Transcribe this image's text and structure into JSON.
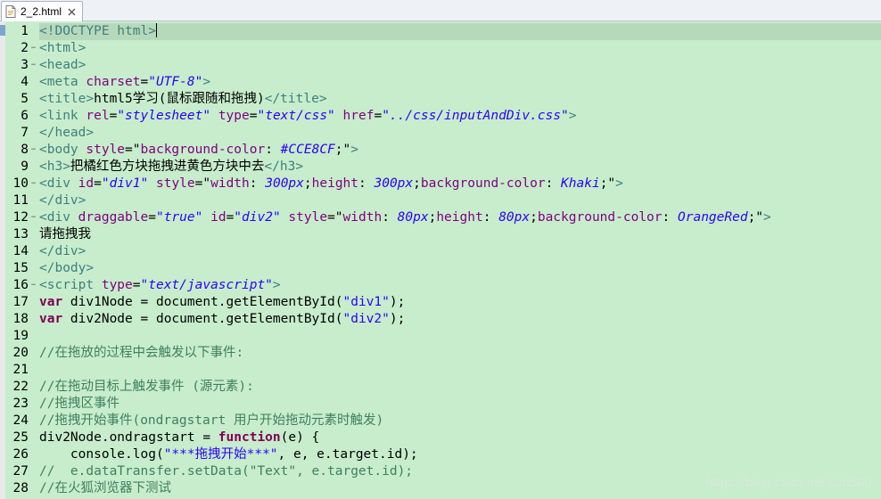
{
  "tab": {
    "title": "2_2.html"
  },
  "editor": {
    "caret_line": 1
  },
  "lines": [
    [
      {
        "c": "tag",
        "t": "<!DOCTYPE html>"
      }
    ],
    [
      {
        "c": "tag",
        "t": "<html>"
      }
    ],
    [
      {
        "c": "tag",
        "t": "<head>"
      }
    ],
    [
      {
        "c": "tag",
        "t": "<meta "
      },
      {
        "c": "attr",
        "t": "charset"
      },
      {
        "c": "plain",
        "t": "="
      },
      {
        "c": "val",
        "t": "\"UTF-8\""
      },
      {
        "c": "tag",
        "t": ">"
      }
    ],
    [
      {
        "c": "tag",
        "t": "<title>"
      },
      {
        "c": "plain",
        "t": "html5学习(鼠标跟随和拖拽)"
      },
      {
        "c": "tag",
        "t": "</title>"
      }
    ],
    [
      {
        "c": "tag",
        "t": "<link "
      },
      {
        "c": "attr",
        "t": "rel"
      },
      {
        "c": "plain",
        "t": "="
      },
      {
        "c": "val",
        "t": "\"stylesheet\""
      },
      {
        "c": "plain",
        "t": " "
      },
      {
        "c": "attr",
        "t": "type"
      },
      {
        "c": "plain",
        "t": "="
      },
      {
        "c": "val",
        "t": "\"text/css\""
      },
      {
        "c": "plain",
        "t": " "
      },
      {
        "c": "attr",
        "t": "href"
      },
      {
        "c": "plain",
        "t": "="
      },
      {
        "c": "val",
        "t": "\"../css/inputAndDiv.css\""
      },
      {
        "c": "tag",
        "t": ">"
      }
    ],
    [
      {
        "c": "tag",
        "t": "</head>"
      }
    ],
    [
      {
        "c": "tag",
        "t": "<body "
      },
      {
        "c": "attr",
        "t": "style"
      },
      {
        "c": "plain",
        "t": "=\""
      },
      {
        "c": "attr",
        "t": "background-color"
      },
      {
        "c": "plain",
        "t": ": "
      },
      {
        "c": "cval",
        "t": "#CCE8CF"
      },
      {
        "c": "plain",
        "t": ";\""
      },
      {
        "c": "tag",
        "t": ">"
      }
    ],
    [
      {
        "c": "tag",
        "t": "<h3>"
      },
      {
        "c": "plain",
        "t": "把橘红色方块拖拽进黄色方块中去"
      },
      {
        "c": "tag",
        "t": "</h3>"
      }
    ],
    [
      {
        "c": "tag",
        "t": "<div "
      },
      {
        "c": "attr",
        "t": "id"
      },
      {
        "c": "plain",
        "t": "="
      },
      {
        "c": "val",
        "t": "\"div1\""
      },
      {
        "c": "plain",
        "t": " "
      },
      {
        "c": "attr",
        "t": "style"
      },
      {
        "c": "plain",
        "t": "=\""
      },
      {
        "c": "attr",
        "t": "width"
      },
      {
        "c": "plain",
        "t": ": "
      },
      {
        "c": "cval",
        "t": "300px"
      },
      {
        "c": "plain",
        "t": ";"
      },
      {
        "c": "attr",
        "t": "height"
      },
      {
        "c": "plain",
        "t": ": "
      },
      {
        "c": "cval",
        "t": "300px"
      },
      {
        "c": "plain",
        "t": ";"
      },
      {
        "c": "attr",
        "t": "background-color"
      },
      {
        "c": "plain",
        "t": ": "
      },
      {
        "c": "cval",
        "t": "Khaki"
      },
      {
        "c": "plain",
        "t": ";\""
      },
      {
        "c": "tag",
        "t": ">"
      }
    ],
    [
      {
        "c": "tag",
        "t": "</div>"
      }
    ],
    [
      {
        "c": "tag",
        "t": "<div "
      },
      {
        "c": "attr",
        "t": "draggable"
      },
      {
        "c": "plain",
        "t": "="
      },
      {
        "c": "val",
        "t": "\"true\""
      },
      {
        "c": "plain",
        "t": " "
      },
      {
        "c": "attr",
        "t": "id"
      },
      {
        "c": "plain",
        "t": "="
      },
      {
        "c": "val",
        "t": "\"div2\""
      },
      {
        "c": "plain",
        "t": " "
      },
      {
        "c": "attr",
        "t": "style"
      },
      {
        "c": "plain",
        "t": "=\""
      },
      {
        "c": "attr",
        "t": "width"
      },
      {
        "c": "plain",
        "t": ": "
      },
      {
        "c": "cval",
        "t": "80px"
      },
      {
        "c": "plain",
        "t": ";"
      },
      {
        "c": "attr",
        "t": "height"
      },
      {
        "c": "plain",
        "t": ": "
      },
      {
        "c": "cval",
        "t": "80px"
      },
      {
        "c": "plain",
        "t": ";"
      },
      {
        "c": "attr",
        "t": "background-color"
      },
      {
        "c": "plain",
        "t": ": "
      },
      {
        "c": "cval",
        "t": "OrangeRed"
      },
      {
        "c": "plain",
        "t": ";\""
      },
      {
        "c": "tag",
        "t": ">"
      }
    ],
    [
      {
        "c": "plain",
        "t": "请拖拽我"
      }
    ],
    [
      {
        "c": "tag",
        "t": "</div>"
      }
    ],
    [
      {
        "c": "tag",
        "t": "</body>"
      }
    ],
    [
      {
        "c": "tag",
        "t": "<script "
      },
      {
        "c": "attr",
        "t": "type"
      },
      {
        "c": "plain",
        "t": "="
      },
      {
        "c": "val",
        "t": "\"text/javascript\""
      },
      {
        "c": "tag",
        "t": ">"
      }
    ],
    [
      {
        "c": "kw",
        "t": "var"
      },
      {
        "c": "plain",
        "t": " div1Node = document.getElementById("
      },
      {
        "c": "str",
        "t": "\"div1\""
      },
      {
        "c": "plain",
        "t": ");"
      }
    ],
    [
      {
        "c": "kw",
        "t": "var"
      },
      {
        "c": "plain",
        "t": " div2Node = document.getElementById("
      },
      {
        "c": "str",
        "t": "\"div2\""
      },
      {
        "c": "plain",
        "t": ");"
      }
    ],
    [],
    [
      {
        "c": "cmt",
        "t": "//在拖放的过程中会触发以下事件:"
      }
    ],
    [],
    [
      {
        "c": "cmt",
        "t": "//在拖动目标上触发事件 (源元素):"
      }
    ],
    [
      {
        "c": "cmt",
        "t": "//拖拽区事件"
      }
    ],
    [
      {
        "c": "cmt",
        "t": "//拖拽开始事件(ondragstart 用户开始拖动元素时触发)"
      }
    ],
    [
      {
        "c": "plain",
        "t": "div2Node.ondragstart = "
      },
      {
        "c": "kw",
        "t": "function"
      },
      {
        "c": "plain",
        "t": "(e) {"
      }
    ],
    [
      {
        "c": "plain",
        "t": "    console.log("
      },
      {
        "c": "str",
        "t": "\"***拖拽开始***\""
      },
      {
        "c": "plain",
        "t": ", e, e.target.id);"
      }
    ],
    [
      {
        "c": "cmt",
        "t": "//  e.dataTransfer.setData(\"Text\", e.target.id);"
      }
    ],
    [
      {
        "c": "cmt",
        "t": "//在火狐浏览器下测试"
      }
    ]
  ],
  "folds": {
    "2": "−",
    "3": "−",
    "8": "−",
    "10": "−",
    "12": "−",
    "16": "−"
  },
  "watermark": "https://blog.csdn.net/czh500",
  "colors": {
    "background": "#c7edcc",
    "current_line": "#b7d9bb",
    "tag": "#3f7f7f",
    "attribute": "#7f007f",
    "value": "#2a00ff",
    "keyword": "#7f0055",
    "comment": "#3f7f5f"
  }
}
